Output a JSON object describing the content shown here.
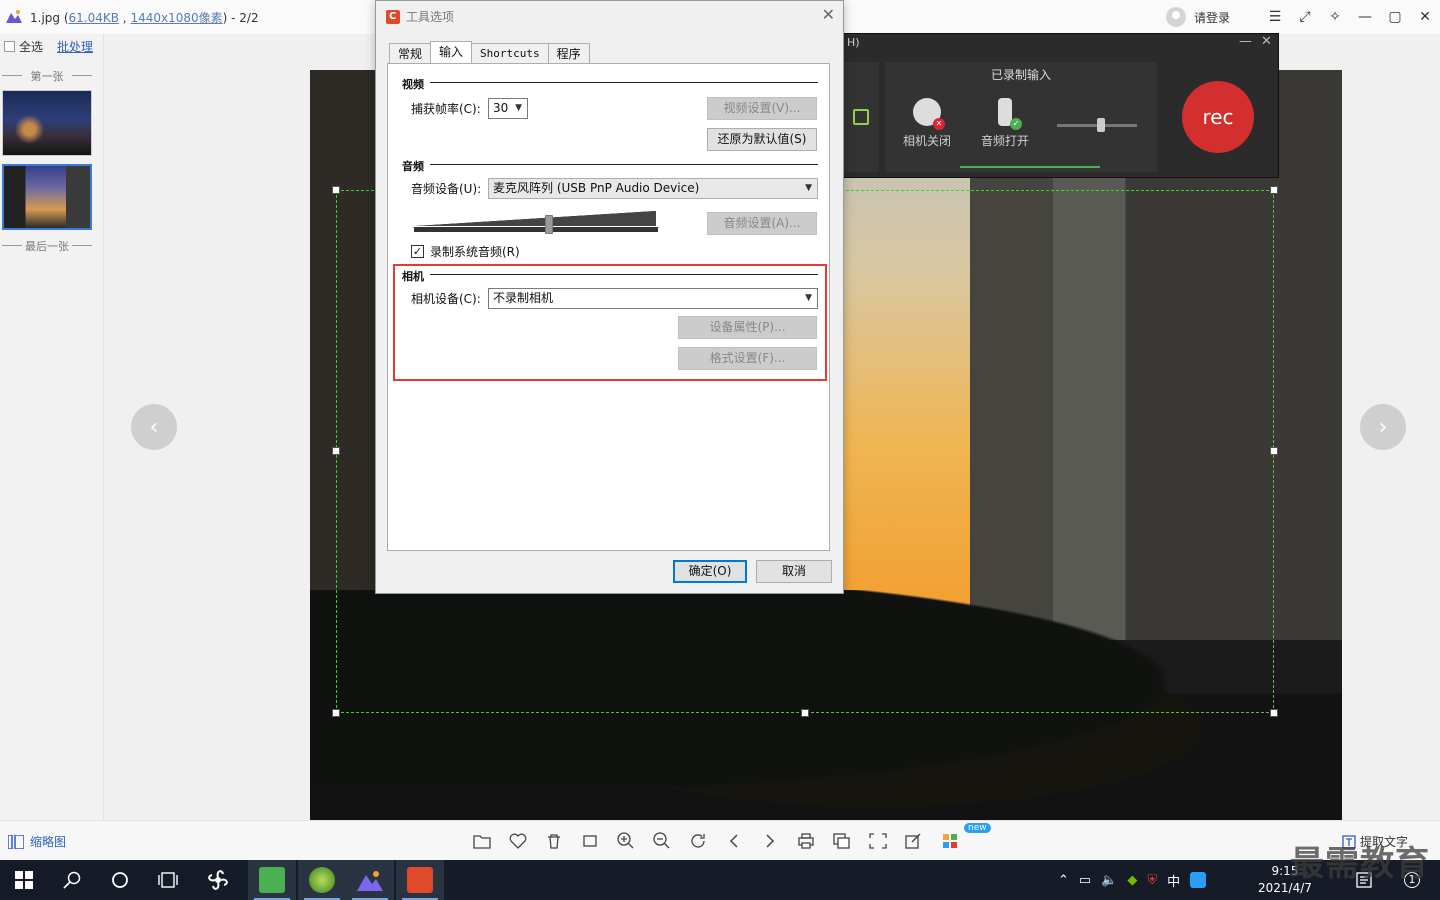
{
  "viewer": {
    "title_prefix": "1.jpg (",
    "title_size": "61.04KB",
    "title_sep": " , ",
    "title_dims": "1440x1080像素",
    "title_suffix": ") - 2/2",
    "login": "请登录",
    "select_all": "全选",
    "batch": "批处理",
    "first": "第一张",
    "last": "最后一张",
    "thumbs_label": "缩略图",
    "extract_text": "提取文字",
    "new_badge": "new",
    "nav_prev": "‹",
    "nav_next": "›",
    "window_buttons": [
      "☰",
      "⤢",
      "✧",
      "—",
      "▢",
      "✕"
    ],
    "toolbar_icons": [
      "folder-icon",
      "heart-icon",
      "trash-icon",
      "crop-icon",
      "zoom-in-icon",
      "zoom-out-icon",
      "rotate-icon",
      "prev-icon",
      "next-icon",
      "print-icon",
      "copy-icon",
      "fit-icon",
      "edit-icon",
      "apps-icon"
    ]
  },
  "recorder": {
    "title": "H)",
    "panel_label": "已录制输入",
    "camera_label": "相机关闭",
    "audio_label": "音频打开",
    "rec_label": "rec",
    "min": "—",
    "close": "✕"
  },
  "dialog": {
    "title": "工具选项",
    "close": "✕",
    "tabs": [
      "常规",
      "输入",
      "Shortcuts",
      "程序"
    ],
    "active_tab": "输入",
    "video": {
      "group": "视频",
      "fps_label": "捕获帧率(C):",
      "fps_value": "30",
      "video_settings": "视频设置(V)...",
      "restore_defaults": "还原为默认值(S)"
    },
    "audio": {
      "group": "音频",
      "device_label": "音频设备(U):",
      "device_value": "麦克风阵列 (USB PnP Audio Device)",
      "audio_settings": "音频设置(A)...",
      "system_audio_label": "录制系统音频(R)",
      "system_audio_checked": true
    },
    "camera": {
      "group": "相机",
      "device_label": "相机设备(C):",
      "device_value": "不录制相机",
      "properties": "设备属性(P)...",
      "format": "格式设置(F)..."
    },
    "ok": "确定(O)",
    "cancel": "取消"
  },
  "taskbar": {
    "tray_lang": "中",
    "time": "9:15",
    "date": "2021/4/7",
    "notif": "1",
    "watermark": "最需教育"
  },
  "colors": {
    "accent": "#0078d7",
    "highlight": "#e53935",
    "rec": "#d32f2f",
    "capture_border": "#37d52f",
    "link": "#2f5fbf"
  }
}
